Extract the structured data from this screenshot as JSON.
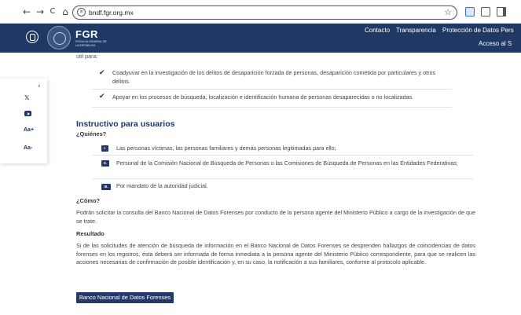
{
  "browser": {
    "back": "←",
    "forward": "→",
    "reload": "C",
    "home": "⌂",
    "url": "bndf.fgr.org.mx"
  },
  "header": {
    "brand_title": "FGR",
    "brand_subtitle": "FISCALÍA GENERAL DE LA REPÚBLICA",
    "nav": [
      "Contacto",
      "Transparencia",
      "Protección de Datos Pers"
    ],
    "acceso": "Acceso al S",
    "color": "#203864"
  },
  "a11y": {
    "collapse": "‹",
    "x": "𝕏",
    "increase": "Aa+",
    "decrease": "Aa-"
  },
  "content": {
    "cut_text": "útil para:",
    "checks": [
      "Coadyuvar en la investigación de los delitos de desaparición forzada de personas, desaparición cometida por particulares y otros delitos.",
      "Apoyar en los procesos de búsqueda, localización e identificación humana de personas desaparecidas o no localizadas."
    ],
    "instructivo_title": "Instructivo para usuarios",
    "quienes": "¿Quiénes?",
    "roman_items": [
      {
        "badge": "I.",
        "text": "Las personas víctimas, las personas familiares y demás personas legitimadas para ello;"
      },
      {
        "badge": "II.",
        "text": "Personal de la Comisión Nacional de Búsqueda de Personas o las Comisiones de Búsqueda de Personas en las Entidades Federativas;"
      },
      {
        "badge": "III.",
        "text": "Por mandato de la autoridad judicial."
      }
    ],
    "como": "¿Cómo?",
    "como_text": "Podrán solicitar la consulta del Banco Nacional de Datos Forenses por conducto de la persona agente del Ministerio Público a cargo de la investigación de que se trate.",
    "resultado": "Resultado",
    "resultado_text": "Si de las solicitudes de atención de búsqueda de información en el Banco Nacional de Datos Forenses se desprenden hallazgos de coincidencias de datos forenses en los registros, ésta deberá ser informada de forma inmediata a la persona agente del Ministerio Público correspondiente, para que se realicen las acciones necesarias de confirmación de posible identificación y, en su caso, la notificación a sus familiares, conforme al protocolo aplicable.",
    "button": "Banco Nacional de Datos Forenses"
  }
}
